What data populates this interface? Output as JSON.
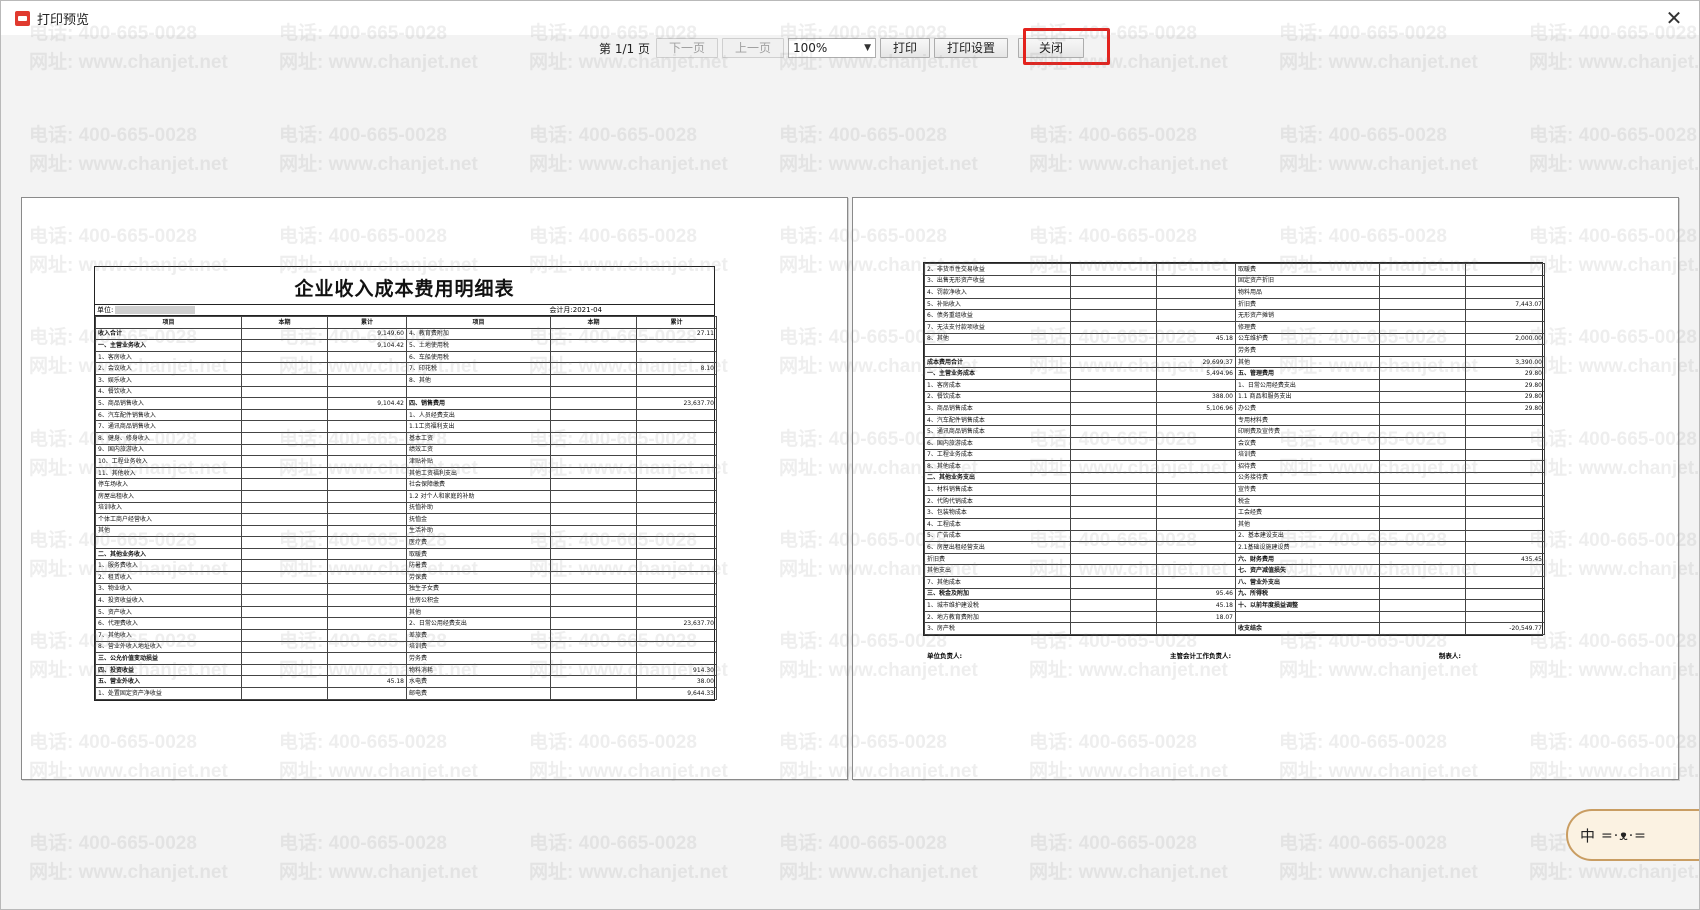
{
  "window": {
    "title": "打印预览",
    "close_glyph": "✕"
  },
  "toolbar": {
    "page_info": "第 1/1 页",
    "next_page": "下一页",
    "prev_page": "上一页",
    "zoom": "100%",
    "print": "打印",
    "print_settings": "打印设置",
    "close": "关闭"
  },
  "watermark": {
    "phone": "电话: 400-665-0028",
    "site": "网址: www.chanjet.net"
  },
  "report": {
    "title": "企业收入成本费用明细表",
    "unit_label": "单位:",
    "period": "会计月:2021-04",
    "headers": [
      "项目",
      "本期",
      "累计",
      "项目",
      "本期",
      "累计"
    ],
    "left_rows": [
      [
        "收入合计",
        "",
        "9,149.60",
        "4、教育费附加",
        "",
        "27.11"
      ],
      [
        "一、主营业务收入",
        "",
        "9,104.42",
        "5、土地使用税",
        "",
        ""
      ],
      [
        "1、客房收入",
        "",
        "",
        "6、车船使用税",
        "",
        ""
      ],
      [
        "2、会议收入",
        "",
        "",
        "7、印花税",
        "",
        "8.10"
      ],
      [
        "3、娱乐收入",
        "",
        "",
        "8、其他",
        "",
        ""
      ],
      [
        "4、餐饮收入",
        "",
        "",
        "",
        "",
        ""
      ],
      [
        "5、商品销售收入",
        "",
        "9,104.42",
        "四、销售费用",
        "",
        "23,637.70"
      ],
      [
        "6、汽车配件销售收入",
        "",
        "",
        "1、人员经费支出",
        "",
        ""
      ],
      [
        "7、通讯商品销售收入",
        "",
        "",
        "1.1工资福利支出",
        "",
        ""
      ],
      [
        "8、健身、修身收入",
        "",
        "",
        "基本工资",
        "",
        ""
      ],
      [
        "9、国内旅游收入",
        "",
        "",
        "绩效工资",
        "",
        ""
      ],
      [
        "10、工程业务收入",
        "",
        "",
        "津贴补贴",
        "",
        ""
      ],
      [
        "11、其他收入",
        "",
        "",
        "其他工资福利支出",
        "",
        ""
      ],
      [
        "停车场收入",
        "",
        "",
        "社会保障缴费",
        "",
        ""
      ],
      [
        "房屋出租收入",
        "",
        "",
        "1.2 对个人和家庭的补助",
        "",
        ""
      ],
      [
        "培训收入",
        "",
        "",
        "抚恤补助",
        "",
        ""
      ],
      [
        "个体工商户经营收入",
        "",
        "",
        "抚恤金",
        "",
        ""
      ],
      [
        "其他",
        "",
        "",
        "生活补助",
        "",
        ""
      ],
      [
        "",
        "",
        "",
        "医疗费",
        "",
        ""
      ],
      [
        "二、其他业务收入",
        "",
        "",
        "取暖费",
        "",
        ""
      ],
      [
        "1、服务费收入",
        "",
        "",
        "防暑费",
        "",
        ""
      ],
      [
        "2、租赁收入",
        "",
        "",
        "劳保费",
        "",
        ""
      ],
      [
        "3、物业收入",
        "",
        "",
        "独生子女费",
        "",
        ""
      ],
      [
        "4、投资收益收入",
        "",
        "",
        "住房公积金",
        "",
        ""
      ],
      [
        "5、资产收入",
        "",
        "",
        "其他",
        "",
        ""
      ],
      [
        "6、代理费收入",
        "",
        "",
        "2、日常公用经费支出",
        "",
        "23,637.70"
      ],
      [
        "7、其他收入",
        "",
        "",
        "差旅费",
        "",
        ""
      ],
      [
        "8、营业外收入地址收入",
        "",
        "",
        "培训费",
        "",
        ""
      ],
      [
        "三、公允价值变动损益",
        "",
        "",
        "劳务费",
        "",
        ""
      ],
      [
        "四、投资收益",
        "",
        "",
        "物料消耗",
        "",
        "914.30"
      ],
      [
        "五、营业外收入",
        "",
        "45.18",
        "水电费",
        "",
        "38.00"
      ],
      [
        "1、处置固定资产净收益",
        "",
        "",
        "邮电费",
        "",
        "9,644.33"
      ]
    ],
    "right_rows": [
      [
        "2、非货币性交易收益",
        "",
        "",
        "取暖费",
        "",
        ""
      ],
      [
        "3、出售无形资产收益",
        "",
        "",
        "固定资产折旧",
        "",
        ""
      ],
      [
        "4、罚款净收入",
        "",
        "",
        "物料用品",
        "",
        ""
      ],
      [
        "5、补贴收入",
        "",
        "",
        "折旧费",
        "",
        "7,443.07"
      ],
      [
        "6、债务重组收益",
        "",
        "",
        "无形资产摊销",
        "",
        ""
      ],
      [
        "7、无法支付款项收益",
        "",
        "",
        "修理费",
        "",
        ""
      ],
      [
        "8、其他",
        "",
        "45.18",
        "公车维护费",
        "",
        "2,000.00"
      ],
      [
        "",
        "",
        "",
        "劳务费",
        "",
        ""
      ],
      [
        "成本费用合计",
        "",
        "29,699.37",
        "其他",
        "",
        "3,390.00"
      ],
      [
        "一、主营业务成本",
        "",
        "5,494.96",
        "五、管理费用",
        "",
        "29.80"
      ],
      [
        "1、客房成本",
        "",
        "",
        "1、日常公用经费支出",
        "",
        "29.80"
      ],
      [
        "2、餐饮成本",
        "",
        "388.00",
        "1.1 商品和服务支出",
        "",
        "29.80"
      ],
      [
        "3、商品销售成本",
        "",
        "5,106.96",
        "办公费",
        "",
        "29.80"
      ],
      [
        "4、汽车配件销售成本",
        "",
        "",
        "专用材料费",
        "",
        ""
      ],
      [
        "5、通讯商品销售成本",
        "",
        "",
        "印刷费及宣传费",
        "",
        ""
      ],
      [
        "6、国内旅游成本",
        "",
        "",
        "会议费",
        "",
        ""
      ],
      [
        "7、工程业务成本",
        "",
        "",
        "培训费",
        "",
        ""
      ],
      [
        "8、其他成本",
        "",
        "",
        "招待费",
        "",
        ""
      ],
      [
        "二、其他业务支出",
        "",
        "",
        "公务接待费",
        "",
        ""
      ],
      [
        "1、材料销售成本",
        "",
        "",
        "宣传费",
        "",
        ""
      ],
      [
        "2、代购代销成本",
        "",
        "",
        "税金",
        "",
        ""
      ],
      [
        "3、包装物成本",
        "",
        "",
        "工会经费",
        "",
        ""
      ],
      [
        "4、工程成本",
        "",
        "",
        "其他",
        "",
        ""
      ],
      [
        "5、广告成本",
        "",
        "",
        "2、基本建设支出",
        "",
        ""
      ],
      [
        "6、房屋出租经营支出",
        "",
        "",
        "2.1基础设施建设费",
        "",
        ""
      ],
      [
        "折旧费",
        "",
        "",
        "六、财务费用",
        "",
        "435.45"
      ],
      [
        "其他支出",
        "",
        "",
        "七、资产减值损失",
        "",
        ""
      ],
      [
        "7、其他成本",
        "",
        "",
        "八、营业外支出",
        "",
        ""
      ],
      [
        "三、税金及附加",
        "",
        "95.46",
        "九、所得税",
        "",
        ""
      ],
      [
        "1、城市维护建设税",
        "",
        "45.18",
        "十、以前年度损益调整",
        "",
        ""
      ],
      [
        "2、地方教育费附加",
        "",
        "18.07",
        "",
        "",
        ""
      ],
      [
        "3、房产税",
        "",
        "",
        "收支结余",
        "",
        "-20,549.77"
      ]
    ],
    "signatures": [
      "单位负责人:",
      "主管会计工作负责人:",
      "制表人:"
    ]
  },
  "mascot": {
    "label": "中",
    "face": "=·ᴥ·="
  }
}
